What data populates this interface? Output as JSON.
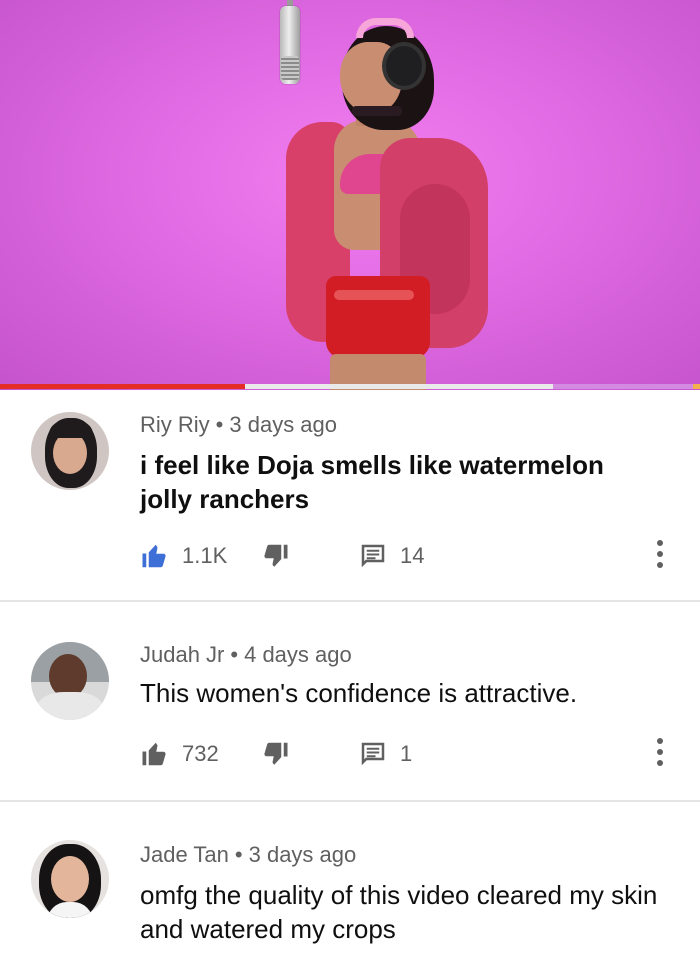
{
  "video": {
    "progress_fraction": 0.35,
    "colors": {
      "played": "#e52d27",
      "buffered": "#d28be0",
      "track": "#e9e9e9",
      "background": "#e46ee6"
    }
  },
  "comments": [
    {
      "author": "Riy Riy",
      "time": "3 days ago",
      "text": "i feel like Doja smells like watermelon jolly ranchers",
      "likes": "1.1K",
      "replies": "14",
      "liked": true
    },
    {
      "author": "Judah Jr",
      "time": "4 days ago",
      "text": "This women's confidence is attractive.",
      "likes": "732",
      "replies": "1",
      "liked": false
    },
    {
      "author": "Jade Tan",
      "time": "3 days ago",
      "text": "omfg the quality of this video cleared my skin and watered my crops"
    }
  ],
  "icons": {
    "like": "thumbs-up-icon",
    "dislike": "thumbs-down-icon",
    "reply": "reply-icon",
    "more": "more-vert-icon"
  },
  "colors": {
    "like_active": "#3e6fd6",
    "icon_default": "#606060"
  }
}
